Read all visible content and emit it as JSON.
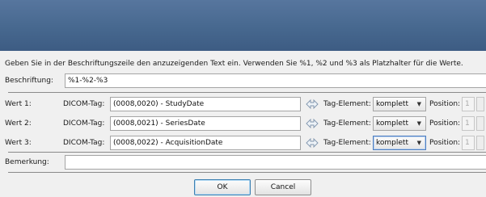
{
  "instruction": "Geben Sie in der Beschriftungszeile den anzuzeigenden Text ein. Verwenden Sie %1, %2 und %3 als Platzhalter für die Werte.",
  "caption": {
    "label": "Beschriftung:",
    "value": "%1-%2-%3"
  },
  "rows": [
    {
      "label": "Wert 1:",
      "dicom_label": "DICOM-Tag:",
      "dicom_value": "(0008,0020) - StudyDate",
      "tag_label": "Tag-Element:",
      "tag_value": "komplett",
      "pos_label": "Position:",
      "pos_value": "1"
    },
    {
      "label": "Wert 2:",
      "dicom_label": "DICOM-Tag:",
      "dicom_value": "(0008,0021) - SeriesDate",
      "tag_label": "Tag-Element:",
      "tag_value": "komplett",
      "pos_label": "Position:",
      "pos_value": "1"
    },
    {
      "label": "Wert 3:",
      "dicom_label": "DICOM-Tag:",
      "dicom_value": "(0008,0022) - AcquisitionDate",
      "tag_label": "Tag-Element:",
      "tag_value": "komplett",
      "pos_label": "Position:",
      "pos_value": "1"
    }
  ],
  "remark": {
    "label": "Bemerkung:",
    "value": ""
  },
  "buttons": {
    "ok": "OK",
    "cancel": "Cancel"
  },
  "colors": {
    "titlebar": "#47688f",
    "background": "#f0f0f0",
    "focus_border": "#4f7fc0"
  }
}
